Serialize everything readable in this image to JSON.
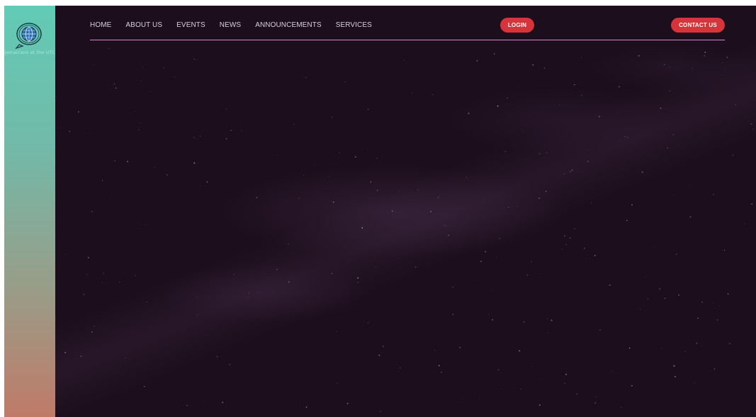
{
  "sidebar": {
    "logo_icon": "globe-speech-bubble-icon",
    "logo_caption": "Jamaicans at the UTC",
    "colors": {
      "top": "#62cbb6",
      "bottom": "#c07a68"
    }
  },
  "header": {
    "nav_items": [
      "HOME",
      "ABOUT US",
      "EVENTS",
      "NEWS",
      "ANNOUNCEMENTS",
      "SERVICES"
    ],
    "login_label": "LOGIN",
    "contact_label": "CONTACT US",
    "colors": {
      "accent": "#d6333a",
      "rule": "#d58fc8",
      "background": "#1c0e1c"
    }
  }
}
